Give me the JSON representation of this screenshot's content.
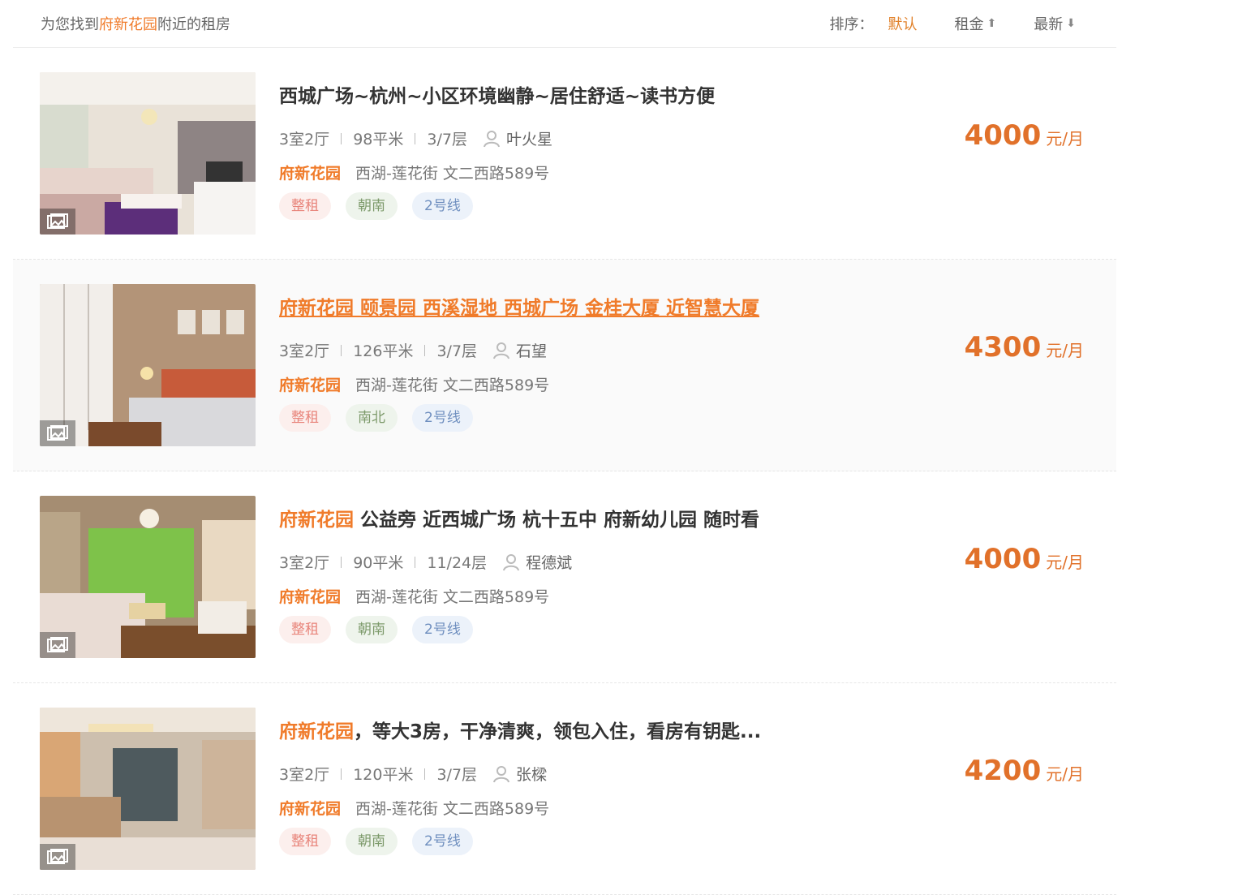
{
  "header": {
    "found_prefix": "为您找到",
    "community": "府新花园",
    "found_suffix": "附近的租房",
    "sort_label": "排序：",
    "sort_default": "默认",
    "sort_rent": "租金",
    "sort_newest": "最新"
  },
  "listings": [
    {
      "title_hl": "",
      "title": "西城广场~杭州~小区环境幽静~居住舒适~读书方便",
      "layout": "3室2厅",
      "area": "98平米",
      "floor": "3/7层",
      "agent": "叶火星",
      "community": "府新花园",
      "address": "西湖-莲花街 文二西路589号",
      "tags": [
        "整租",
        "朝南",
        "2号线"
      ],
      "price": "4000",
      "unit": "元/月"
    },
    {
      "title_hl": "",
      "title": "府新花园 颐景园 西溪湿地 西城广场 金桂大厦 近智慧大厦",
      "layout": "3室2厅",
      "area": "126平米",
      "floor": "3/7层",
      "agent": "石望",
      "community": "府新花园",
      "address": "西湖-莲花街 文二西路589号",
      "tags": [
        "整租",
        "南北",
        "2号线"
      ],
      "price": "4300",
      "unit": "元/月"
    },
    {
      "title_hl": "府新花园",
      "title": " 公益旁 近西城广场 杭十五中 府新幼儿园 随时看",
      "layout": "3室2厅",
      "area": "90平米",
      "floor": "11/24层",
      "agent": "程德斌",
      "community": "府新花园",
      "address": "西湖-莲花街 文二西路589号",
      "tags": [
        "整租",
        "朝南",
        "2号线"
      ],
      "price": "4000",
      "unit": "元/月"
    },
    {
      "title_hl": "府新花园",
      "title": "，等大3房，干净清爽，领包入住，看房有钥匙...",
      "layout": "3室2厅",
      "area": "120平米",
      "floor": "3/7层",
      "agent": "张樑",
      "community": "府新花园",
      "address": "西湖-莲花街 文二西路589号",
      "tags": [
        "整租",
        "朝南",
        "2号线"
      ],
      "price": "4200",
      "unit": "元/月"
    }
  ],
  "colors": {
    "accent": "#f07b2a",
    "price": "#e1712a",
    "tag_rent": "#e8847a",
    "tag_orient": "#7d9a6b",
    "tag_line": "#6f8fbf"
  },
  "icons": [
    "photo-gallery-icon",
    "person-icon",
    "arrow-up-icon",
    "arrow-down-icon"
  ]
}
